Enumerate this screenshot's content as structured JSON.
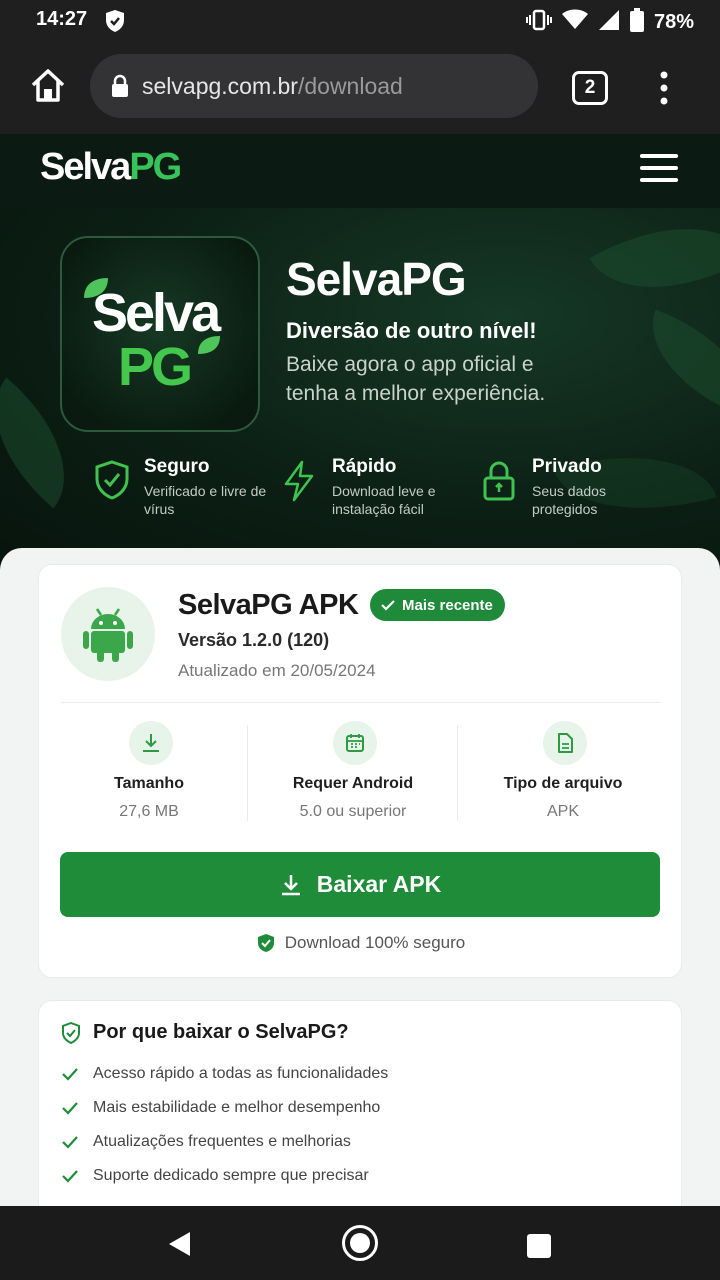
{
  "status_bar": {
    "time": "14:27",
    "battery": "78%"
  },
  "browser": {
    "url_domain": "selvapg.com.br",
    "url_path": "/download",
    "tab_count": "2"
  },
  "site_header": {
    "logo_part1": "Selva",
    "logo_part2": "PG"
  },
  "hero": {
    "tile_line1": "Selva",
    "tile_line2": "PG",
    "title": "SelvaPG",
    "subtitle": "Diversão de outro nível!",
    "description": "Baixe agora o app oficial e tenha a melhor experiência.",
    "features": [
      {
        "title": "Seguro",
        "desc": "Verificado e livre de vírus",
        "icon": "shield-check-icon"
      },
      {
        "title": "Rápido",
        "desc": "Download leve e instalação fácil",
        "icon": "lightning-icon"
      },
      {
        "title": "Privado",
        "desc": "Seus dados protegidos",
        "icon": "lock-icon"
      }
    ]
  },
  "apk_card": {
    "title": "SelvaPG APK",
    "badge": "Mais recente",
    "version": "Versão 1.2.0 (120)",
    "updated": "Atualizado em 20/05/2024",
    "stats": [
      {
        "label": "Tamanho",
        "value": "27,6 MB",
        "icon": "download-icon"
      },
      {
        "label": "Requer Android",
        "value": "5.0 ou superior",
        "icon": "calendar-icon"
      },
      {
        "label": "Tipo de arquivo",
        "value": "APK",
        "icon": "file-icon"
      }
    ],
    "download_button": "Baixar APK",
    "secure_note": "Download 100% seguro"
  },
  "why_card": {
    "title": "Por que baixar o SelvaPG?",
    "items": [
      "Acesso rápido a todas as funcionalidades",
      "Mais estabilidade e melhor desempenho",
      "Atualizações frequentes e melhorias",
      "Suporte dedicado sempre que precisar"
    ]
  },
  "colors": {
    "brand_green": "#1e8c39",
    "accent_green": "#38c25a",
    "header_bg": "#0b1a13"
  }
}
